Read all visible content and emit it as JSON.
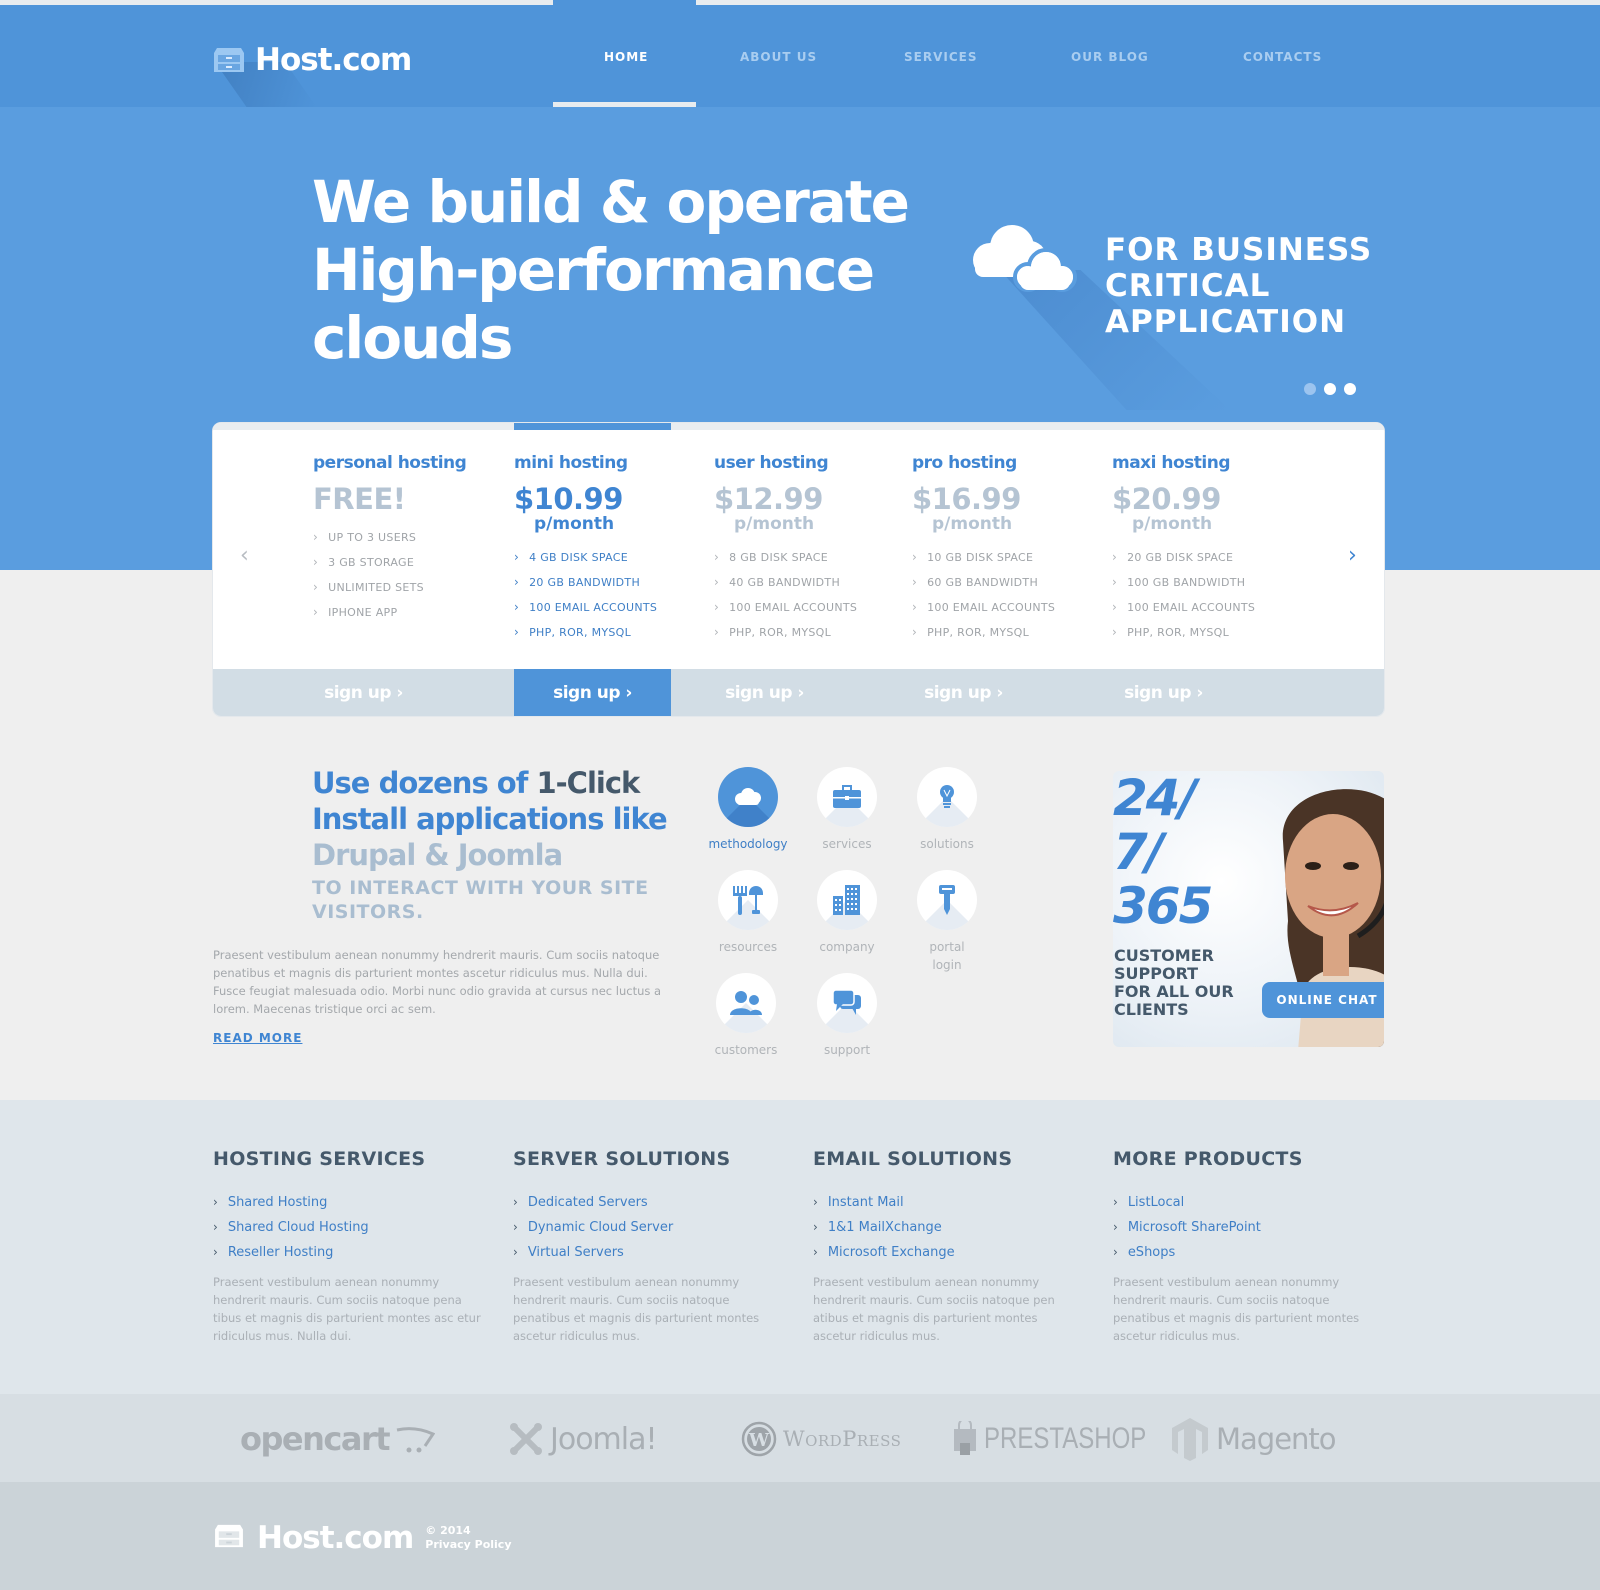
{
  "header": {
    "logo_text": "Host.com",
    "nav": [
      {
        "label": "HOME",
        "active": true
      },
      {
        "label": "ABOUT US",
        "active": false
      },
      {
        "label": "SERVICES",
        "active": false
      },
      {
        "label": "OUR BLOG",
        "active": false
      },
      {
        "label": "CONTACTS",
        "active": false
      }
    ]
  },
  "hero": {
    "title_lines": [
      "We build & operate",
      "High-performance",
      "clouds"
    ],
    "subtitle_lines": [
      "FOR BUSINESS",
      "CRITICAL",
      "APPLICATION"
    ],
    "slides_count": 3,
    "active_slide": 1
  },
  "pricing": {
    "plans": [
      {
        "name": "personal hosting",
        "price": "FREE!",
        "period": "",
        "features": [
          "UP TO 3 USERS",
          "3 GB STORAGE",
          "UNLIMITED SETS",
          "IPHONE APP"
        ],
        "active": false
      },
      {
        "name": "mini hosting",
        "price": "$10.99",
        "period": "p/month",
        "features": [
          "4 GB DISK SPACE",
          "20 GB BANDWIDTH",
          "100 EMAIL ACCOUNTS",
          "PHP, ROR, MYSQL"
        ],
        "active": true
      },
      {
        "name": "user hosting",
        "price": "$12.99",
        "period": "p/month",
        "features": [
          "8 GB DISK SPACE",
          "40 GB BANDWIDTH",
          "100 EMAIL ACCOUNTS",
          "PHP, ROR, MYSQL"
        ],
        "active": false
      },
      {
        "name": "pro hosting",
        "price": "$16.99",
        "period": "p/month",
        "features": [
          "10 GB DISK SPACE",
          "60 GB BANDWIDTH",
          "100 EMAIL ACCOUNTS",
          "PHP, ROR, MYSQL"
        ],
        "active": false
      },
      {
        "name": "maxi hosting",
        "price": "$20.99",
        "period": "p/month",
        "features": [
          "20 GB DISK SPACE",
          "100 GB BANDWIDTH",
          "100 EMAIL ACCOUNTS",
          "PHP, ROR, MYSQL"
        ],
        "active": false
      }
    ],
    "signup_label": "sign up ›",
    "prev_arrow": "‹",
    "next_arrow": "›"
  },
  "apps": {
    "title_part1": "Use dozens of ",
    "title_part2": "1-Click",
    "title_part3": " Install applications like ",
    "title_part4": "Drupal & Joomla",
    "subtitle": "TO INTERACT WITH YOUR SITE VISITORS.",
    "body": "Praesent vestibulum aenean nonummy hendrerit mauris. Cum sociis natoque penatibus et magnis dis parturient montes ascetur ridiculus mus. Nulla dui. Fusce feugiat malesuada odio. Morbi nunc odio gravida at cursus nec luctus a lorem. Maecenas tristique orci ac sem.",
    "read_more": "READ MORE"
  },
  "icon_grid": [
    {
      "label": "methodology",
      "icon": "cloud-icon",
      "active": true
    },
    {
      "label": "services",
      "icon": "briefcase-icon",
      "active": false
    },
    {
      "label": "solutions",
      "icon": "lightbulb-icon",
      "active": false
    },
    {
      "label": "resources",
      "icon": "tools-icon",
      "active": false
    },
    {
      "label": "company",
      "icon": "building-icon",
      "active": false
    },
    {
      "label": "portal login",
      "icon": "key-icon",
      "active": false
    },
    {
      "label": "customers",
      "icon": "users-icon",
      "active": false
    },
    {
      "label": "support",
      "icon": "chat-icon",
      "active": false
    }
  ],
  "support": {
    "big_lines": [
      "24/",
      "7/",
      "365"
    ],
    "small_lines": [
      "CUSTOMER",
      "SUPPORT",
      "FOR ALL OUR",
      "CLIENTS"
    ],
    "chat_button": "ONLINE CHAT"
  },
  "footer_columns": [
    {
      "title": "HOSTING SERVICES",
      "links": [
        "Shared Hosting",
        "Shared Cloud Hosting",
        "Reseller Hosting"
      ],
      "text": "Praesent vestibulum aenean nonummy hendrerit mauris. Cum sociis natoque pena tibus et magnis dis parturient montes asc etur ridiculus mus. Nulla dui."
    },
    {
      "title": "SERVER SOLUTIONS",
      "links": [
        "Dedicated Servers",
        "Dynamic Cloud Server",
        "Virtual Servers"
      ],
      "text": "Praesent vestibulum aenean nonummy hendrerit mauris. Cum sociis natoque penatibus et magnis dis parturient montes ascetur ridiculus mus."
    },
    {
      "title": "EMAIL SOLUTIONS",
      "links": [
        "Instant Mail",
        "1&1 MailXchange",
        "Microsoft Exchange"
      ],
      "text": "Praesent vestibulum aenean nonummy hendrerit mauris. Cum sociis natoque pen atibus et magnis dis parturient montes ascetur ridiculus mus."
    },
    {
      "title": "MORE PRODUCTS",
      "links": [
        "ListLocal",
        "Microsoft SharePoint",
        "eShops"
      ],
      "text": "Praesent vestibulum aenean nonummy hendrerit mauris. Cum sociis natoque penatibus et magnis dis parturient montes ascetur ridiculus mus."
    }
  ],
  "partners": [
    "opencart",
    "Joomla!",
    "WordPress",
    "PRESTASHOP",
    "Magento"
  ],
  "footer": {
    "logo_text": "Host.com",
    "copyright": "© 2014",
    "privacy": "Privacy Policy"
  },
  "colors": {
    "brand_blue": "#4f94d9",
    "hero_blue": "#5a9ddf",
    "accent_text": "#3f85d2",
    "dark_slate": "#45596b",
    "muted_blue": "#a9bdd0"
  }
}
